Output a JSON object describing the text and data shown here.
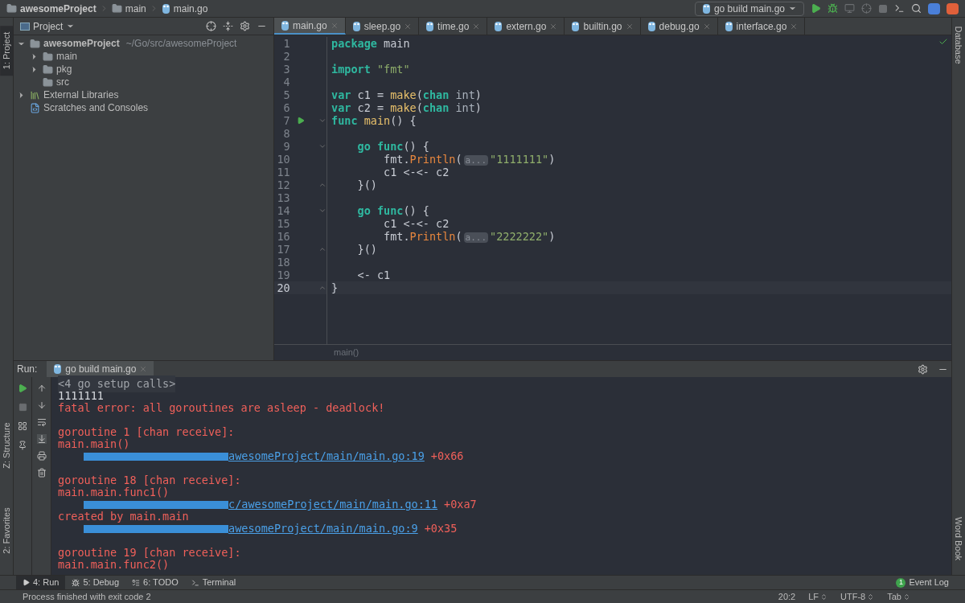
{
  "breadcrumbs": [
    {
      "label": "awesomeProject",
      "kind": "folder"
    },
    {
      "label": "main",
      "kind": "folder"
    },
    {
      "label": "main.go",
      "kind": "file"
    }
  ],
  "run_config": "go build main.go",
  "left_strip": [
    {
      "label": "1: Project",
      "selected": true
    },
    {
      "label": "Z: Structure",
      "selected": false
    },
    {
      "label": "2: Favorites",
      "selected": false
    }
  ],
  "right_strip": [
    {
      "label": "Database"
    },
    {
      "label": "Word Book"
    }
  ],
  "project": {
    "title": "Project",
    "tree": [
      {
        "label": "awesomeProject",
        "path": "~/Go/src/awesomeProject",
        "kind": "folder",
        "expanded": true,
        "children": [
          {
            "label": "main",
            "kind": "folder",
            "expanded": false
          },
          {
            "label": "pkg",
            "kind": "folder",
            "expanded": false
          },
          {
            "label": "src",
            "kind": "folder"
          }
        ]
      },
      {
        "label": "External Libraries",
        "kind": "library",
        "expanded": false
      },
      {
        "label": "Scratches and Consoles",
        "kind": "scratch"
      }
    ]
  },
  "tabs": [
    {
      "label": "main.go",
      "selected": true
    },
    {
      "label": "sleep.go",
      "selected": false
    },
    {
      "label": "time.go",
      "selected": false
    },
    {
      "label": "extern.go",
      "selected": false
    },
    {
      "label": "builtin.go",
      "selected": false
    },
    {
      "label": "debug.go",
      "selected": false
    },
    {
      "label": "interface.go",
      "selected": false
    }
  ],
  "editor": {
    "lines": [
      {
        "n": "1",
        "current": false,
        "run": false,
        "fold_start": false,
        "fold_end": false,
        "tokens": [
          {
            "kind": "kw",
            "t": "package"
          },
          {
            "kind": "plain",
            "t": " main"
          }
        ]
      },
      {
        "n": "2",
        "current": false,
        "run": false,
        "fold_start": false,
        "fold_end": false
      },
      {
        "n": "3",
        "current": false,
        "run": false,
        "fold_start": false,
        "fold_end": false,
        "tokens": [
          {
            "kind": "kw",
            "t": "import"
          },
          {
            "kind": "str",
            "t": " \"fmt\""
          }
        ]
      },
      {
        "n": "4",
        "current": false,
        "run": false,
        "fold_start": false,
        "fold_end": false
      },
      {
        "n": "5",
        "current": false,
        "run": false,
        "fold_start": false,
        "fold_end": false,
        "tokens": [
          {
            "kind": "kw",
            "t": "var"
          },
          {
            "kind": "plain",
            "t": " c1 = "
          },
          {
            "kind": "call",
            "t": "make"
          },
          {
            "kind": "plain",
            "t": "("
          },
          {
            "kind": "kw",
            "t": "chan"
          },
          {
            "kind": "type",
            "t": " int"
          },
          {
            "kind": "plain",
            "t": ")"
          }
        ]
      },
      {
        "n": "6",
        "current": false,
        "run": false,
        "fold_start": false,
        "fold_end": false,
        "tokens": [
          {
            "kind": "kw",
            "t": "var"
          },
          {
            "kind": "plain",
            "t": " c2 = "
          },
          {
            "kind": "call",
            "t": "make"
          },
          {
            "kind": "plain",
            "t": "("
          },
          {
            "kind": "kw",
            "t": "chan"
          },
          {
            "kind": "type",
            "t": " int"
          },
          {
            "kind": "plain",
            "t": ")"
          }
        ]
      },
      {
        "n": "7",
        "current": false,
        "run": true,
        "fold_start": true,
        "fold_end": false,
        "tokens": [
          {
            "kind": "kw",
            "t": "func"
          },
          {
            "kind": "call",
            "t": " main"
          },
          {
            "kind": "plain",
            "t": "() {"
          }
        ]
      },
      {
        "n": "8",
        "current": false,
        "run": false,
        "fold_start": false,
        "fold_end": false
      },
      {
        "n": "9",
        "current": false,
        "run": false,
        "fold_start": true,
        "fold_end": false,
        "tokens": [
          {
            "kind": "kw",
            "t": "    go"
          },
          {
            "kind": "kw",
            "t": " func"
          },
          {
            "kind": "plain",
            "t": "() {"
          }
        ]
      },
      {
        "n": "10",
        "current": false,
        "run": false,
        "fold_start": false,
        "fold_end": false,
        "tokens": [
          {
            "kind": "plain",
            "t": "        fmt."
          },
          {
            "kind": "method",
            "t": "Println"
          },
          {
            "kind": "plain",
            "t": "("
          },
          {
            "kind": "hint",
            "t": "a..."
          },
          {
            "kind": "str",
            "t": "\"1111111\""
          },
          {
            "kind": "plain",
            "t": ")"
          }
        ]
      },
      {
        "n": "11",
        "current": false,
        "run": false,
        "fold_start": false,
        "fold_end": false,
        "tokens": [
          {
            "kind": "plain",
            "t": "        c1 <-<- c2"
          }
        ]
      },
      {
        "n": "12",
        "current": false,
        "run": false,
        "fold_start": false,
        "fold_end": true,
        "tokens": [
          {
            "kind": "plain",
            "t": "    }()"
          }
        ]
      },
      {
        "n": "13",
        "current": false,
        "run": false,
        "fold_start": false,
        "fold_end": false
      },
      {
        "n": "14",
        "current": false,
        "run": false,
        "fold_start": true,
        "fold_end": false,
        "tokens": [
          {
            "kind": "kw",
            "t": "    go"
          },
          {
            "kind": "kw",
            "t": " func"
          },
          {
            "kind": "plain",
            "t": "() {"
          }
        ]
      },
      {
        "n": "15",
        "current": false,
        "run": false,
        "fold_start": false,
        "fold_end": false,
        "tokens": [
          {
            "kind": "plain",
            "t": "        c1 <-<- c2"
          }
        ]
      },
      {
        "n": "16",
        "current": false,
        "run": false,
        "fold_start": false,
        "fold_end": false,
        "tokens": [
          {
            "kind": "plain",
            "t": "        fmt."
          },
          {
            "kind": "method",
            "t": "Println"
          },
          {
            "kind": "plain",
            "t": "("
          },
          {
            "kind": "hint",
            "t": "a..."
          },
          {
            "kind": "str",
            "t": "\"2222222\""
          },
          {
            "kind": "plain",
            "t": ")"
          }
        ]
      },
      {
        "n": "17",
        "current": false,
        "run": false,
        "fold_start": false,
        "fold_end": true,
        "tokens": [
          {
            "kind": "plain",
            "t": "    }()"
          }
        ]
      },
      {
        "n": "18",
        "current": false,
        "run": false,
        "fold_start": false,
        "fold_end": false
      },
      {
        "n": "19",
        "current": false,
        "run": false,
        "fold_start": false,
        "fold_end": false,
        "tokens": [
          {
            "kind": "plain",
            "t": "    <- c1"
          }
        ]
      },
      {
        "n": "20",
        "current": true,
        "run": false,
        "fold_start": false,
        "fold_end": true,
        "tokens": [
          {
            "kind": "plain",
            "t": "}"
          }
        ]
      }
    ],
    "breadcrumb": "main()"
  },
  "run": {
    "label": "Run:",
    "tab": "go build main.go",
    "lines": [
      {
        "kind": "folded",
        "text": "<4 go setup calls>"
      },
      {
        "kind": "output",
        "text": "1111111"
      },
      {
        "kind": "error",
        "text": "fatal error: all goroutines are asleep - deadlock!"
      },
      {
        "kind": "blank"
      },
      {
        "kind": "error",
        "text": "goroutine 1 [chan receive]:"
      },
      {
        "kind": "error",
        "text": "main.main()"
      },
      {
        "kind": "trace",
        "link": "awesomeProject/main/main.go:19",
        "offset": "+0x66"
      },
      {
        "kind": "blank"
      },
      {
        "kind": "error",
        "text": "goroutine 18 [chan receive]:"
      },
      {
        "kind": "error",
        "text": "main.main.func1()"
      },
      {
        "kind": "trace",
        "link": "c/awesomeProject/main/main.go:11",
        "offset": "+0xa7"
      },
      {
        "kind": "error",
        "text": "created by main.main"
      },
      {
        "kind": "trace",
        "link": "awesomeProject/main/main.go:9",
        "offset": "+0x35"
      },
      {
        "kind": "blank"
      },
      {
        "kind": "error",
        "text": "goroutine 19 [chan receive]:"
      },
      {
        "kind": "error",
        "text": "main.main.func2()"
      }
    ]
  },
  "tool_tabs": [
    {
      "label": "4: Run",
      "selected": true
    },
    {
      "label": "5: Debug",
      "selected": false
    },
    {
      "label": "6: TODO",
      "selected": false
    },
    {
      "label": "Terminal",
      "selected": false
    }
  ],
  "event_log": {
    "label": "Event Log",
    "count": "1"
  },
  "status": {
    "message": "Process finished with exit code 2",
    "items": [
      {
        "label": "20:2",
        "dropdown": false
      },
      {
        "label": "LF",
        "dropdown": true
      },
      {
        "label": "UTF-8",
        "dropdown": true
      },
      {
        "label": "Tab",
        "dropdown": true
      }
    ]
  }
}
